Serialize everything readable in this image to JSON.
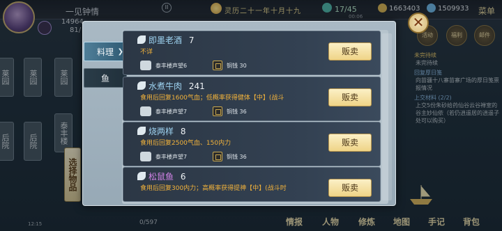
{
  "header": {
    "player_name": "一见钟情",
    "hp": "14964",
    "sp": "81/",
    "date": "灵历二十一年十月十九",
    "stamina": "17/45",
    "time": "00:06",
    "coins": "1663403",
    "gems": "1509933",
    "menu_label": "菜单"
  },
  "map": {
    "tiles": [
      "莱园",
      "莱园",
      "莱园",
      "后院",
      "后院",
      "泰丰楼"
    ],
    "vertical_button": "选择物品"
  },
  "bottom": {
    "clock": "12:15",
    "bag_count": "0/597",
    "nav": [
      "情报",
      "人物",
      "修炼",
      "地图",
      "手记",
      "背包"
    ]
  },
  "quests": [
    {
      "title": "未完待续",
      "desc": "未完待续",
      "type": "gold"
    },
    {
      "title": "回复厚日笺",
      "desc": "向苗疆十八寨苗寨广场的厚日笺禀报情况",
      "type": "blue"
    },
    {
      "title": "上交材料 (2/2)",
      "desc": "上交5份朱砂给药仙谷云谷禅室的谷主妙仙依（若仍逍遥居的逍遥子处可以购买）",
      "type": "blue"
    }
  ],
  "right_icons": [
    "活动",
    "福利",
    "邮件"
  ],
  "modal": {
    "tabs": [
      {
        "label": "料理",
        "active": true
      },
      {
        "label": "鱼",
        "active": false
      }
    ],
    "items": [
      {
        "name": "即墨老酒",
        "count": "7",
        "desc": "不详",
        "reputation": "泰丰楼声望6",
        "price": "铜钱 30",
        "color": "#9fd4f2"
      },
      {
        "name": "水煮牛肉",
        "count": "241",
        "desc": "食用后回复1600气血；低概率获得健体【中】(战斗",
        "reputation": "泰丰楼声望7",
        "price": "铜钱 36",
        "color": "#9fd4f2"
      },
      {
        "name": "烧两样",
        "count": "8",
        "desc": "食用后回复2500气血、150内力",
        "reputation": "泰丰楼声望7",
        "price": "铜钱 36",
        "color": "#9fd4f2"
      },
      {
        "name": "松鼠鱼",
        "count": "6",
        "desc": "食用后回复300内力；高概率获得提神【中】(战斗时",
        "reputation": "",
        "price": "",
        "color": "#d283e8"
      }
    ],
    "sell_label": "贩卖",
    "close_icon": "close-icon"
  }
}
